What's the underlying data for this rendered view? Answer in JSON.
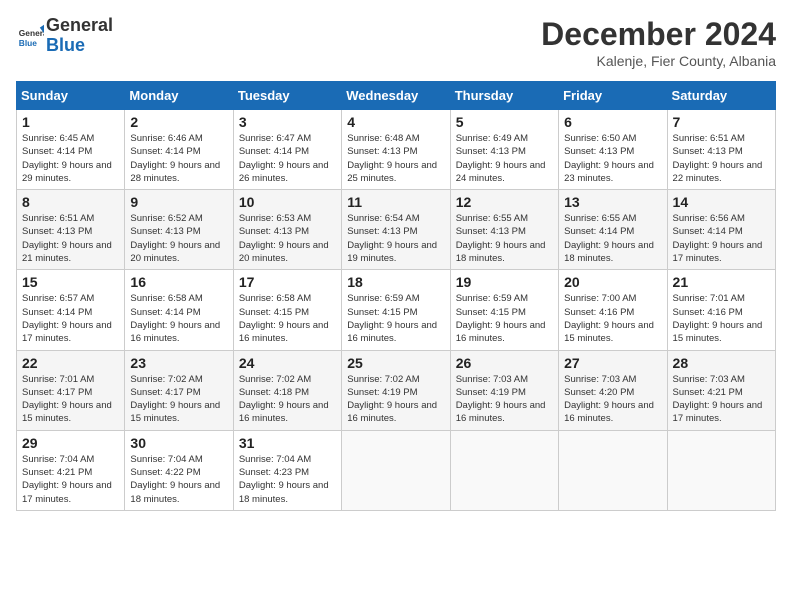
{
  "logo": {
    "general": "General",
    "blue": "Blue"
  },
  "title": "December 2024",
  "subtitle": "Kalenje, Fier County, Albania",
  "days_of_week": [
    "Sunday",
    "Monday",
    "Tuesday",
    "Wednesday",
    "Thursday",
    "Friday",
    "Saturday"
  ],
  "weeks": [
    [
      {
        "day": "1",
        "sunrise": "6:45 AM",
        "sunset": "4:14 PM",
        "daylight": "9 hours and 29 minutes."
      },
      {
        "day": "2",
        "sunrise": "6:46 AM",
        "sunset": "4:14 PM",
        "daylight": "9 hours and 28 minutes."
      },
      {
        "day": "3",
        "sunrise": "6:47 AM",
        "sunset": "4:14 PM",
        "daylight": "9 hours and 26 minutes."
      },
      {
        "day": "4",
        "sunrise": "6:48 AM",
        "sunset": "4:13 PM",
        "daylight": "9 hours and 25 minutes."
      },
      {
        "day": "5",
        "sunrise": "6:49 AM",
        "sunset": "4:13 PM",
        "daylight": "9 hours and 24 minutes."
      },
      {
        "day": "6",
        "sunrise": "6:50 AM",
        "sunset": "4:13 PM",
        "daylight": "9 hours and 23 minutes."
      },
      {
        "day": "7",
        "sunrise": "6:51 AM",
        "sunset": "4:13 PM",
        "daylight": "9 hours and 22 minutes."
      }
    ],
    [
      {
        "day": "8",
        "sunrise": "6:51 AM",
        "sunset": "4:13 PM",
        "daylight": "9 hours and 21 minutes."
      },
      {
        "day": "9",
        "sunrise": "6:52 AM",
        "sunset": "4:13 PM",
        "daylight": "9 hours and 20 minutes."
      },
      {
        "day": "10",
        "sunrise": "6:53 AM",
        "sunset": "4:13 PM",
        "daylight": "9 hours and 20 minutes."
      },
      {
        "day": "11",
        "sunrise": "6:54 AM",
        "sunset": "4:13 PM",
        "daylight": "9 hours and 19 minutes."
      },
      {
        "day": "12",
        "sunrise": "6:55 AM",
        "sunset": "4:13 PM",
        "daylight": "9 hours and 18 minutes."
      },
      {
        "day": "13",
        "sunrise": "6:55 AM",
        "sunset": "4:14 PM",
        "daylight": "9 hours and 18 minutes."
      },
      {
        "day": "14",
        "sunrise": "6:56 AM",
        "sunset": "4:14 PM",
        "daylight": "9 hours and 17 minutes."
      }
    ],
    [
      {
        "day": "15",
        "sunrise": "6:57 AM",
        "sunset": "4:14 PM",
        "daylight": "9 hours and 17 minutes."
      },
      {
        "day": "16",
        "sunrise": "6:58 AM",
        "sunset": "4:14 PM",
        "daylight": "9 hours and 16 minutes."
      },
      {
        "day": "17",
        "sunrise": "6:58 AM",
        "sunset": "4:15 PM",
        "daylight": "9 hours and 16 minutes."
      },
      {
        "day": "18",
        "sunrise": "6:59 AM",
        "sunset": "4:15 PM",
        "daylight": "9 hours and 16 minutes."
      },
      {
        "day": "19",
        "sunrise": "6:59 AM",
        "sunset": "4:15 PM",
        "daylight": "9 hours and 16 minutes."
      },
      {
        "day": "20",
        "sunrise": "7:00 AM",
        "sunset": "4:16 PM",
        "daylight": "9 hours and 15 minutes."
      },
      {
        "day": "21",
        "sunrise": "7:01 AM",
        "sunset": "4:16 PM",
        "daylight": "9 hours and 15 minutes."
      }
    ],
    [
      {
        "day": "22",
        "sunrise": "7:01 AM",
        "sunset": "4:17 PM",
        "daylight": "9 hours and 15 minutes."
      },
      {
        "day": "23",
        "sunrise": "7:02 AM",
        "sunset": "4:17 PM",
        "daylight": "9 hours and 15 minutes."
      },
      {
        "day": "24",
        "sunrise": "7:02 AM",
        "sunset": "4:18 PM",
        "daylight": "9 hours and 16 minutes."
      },
      {
        "day": "25",
        "sunrise": "7:02 AM",
        "sunset": "4:19 PM",
        "daylight": "9 hours and 16 minutes."
      },
      {
        "day": "26",
        "sunrise": "7:03 AM",
        "sunset": "4:19 PM",
        "daylight": "9 hours and 16 minutes."
      },
      {
        "day": "27",
        "sunrise": "7:03 AM",
        "sunset": "4:20 PM",
        "daylight": "9 hours and 16 minutes."
      },
      {
        "day": "28",
        "sunrise": "7:03 AM",
        "sunset": "4:21 PM",
        "daylight": "9 hours and 17 minutes."
      }
    ],
    [
      {
        "day": "29",
        "sunrise": "7:04 AM",
        "sunset": "4:21 PM",
        "daylight": "9 hours and 17 minutes."
      },
      {
        "day": "30",
        "sunrise": "7:04 AM",
        "sunset": "4:22 PM",
        "daylight": "9 hours and 18 minutes."
      },
      {
        "day": "31",
        "sunrise": "7:04 AM",
        "sunset": "4:23 PM",
        "daylight": "9 hours and 18 minutes."
      },
      null,
      null,
      null,
      null
    ]
  ]
}
